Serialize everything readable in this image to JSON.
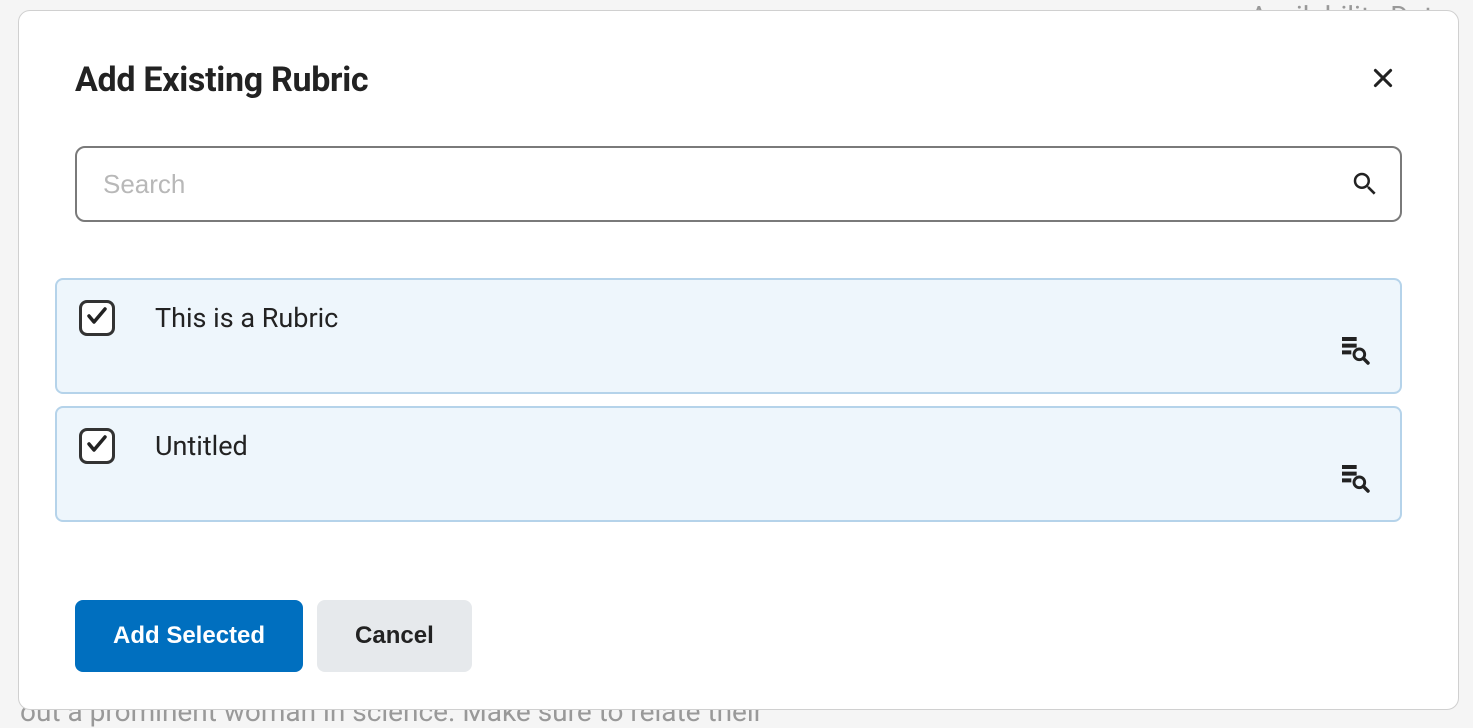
{
  "modal": {
    "title": "Add Existing Rubric",
    "close_label": "Close"
  },
  "search": {
    "placeholder": "Search",
    "value": ""
  },
  "rubrics": {
    "items": [
      {
        "label": "This is a Rubric",
        "checked": true
      },
      {
        "label": "Untitled",
        "checked": true
      }
    ]
  },
  "buttons": {
    "primary": "Add Selected",
    "secondary": "Cancel"
  },
  "icons": {
    "close": "close-icon",
    "search": "search-icon",
    "check": "checkmark-icon",
    "preview": "preview-rubric-icon"
  }
}
